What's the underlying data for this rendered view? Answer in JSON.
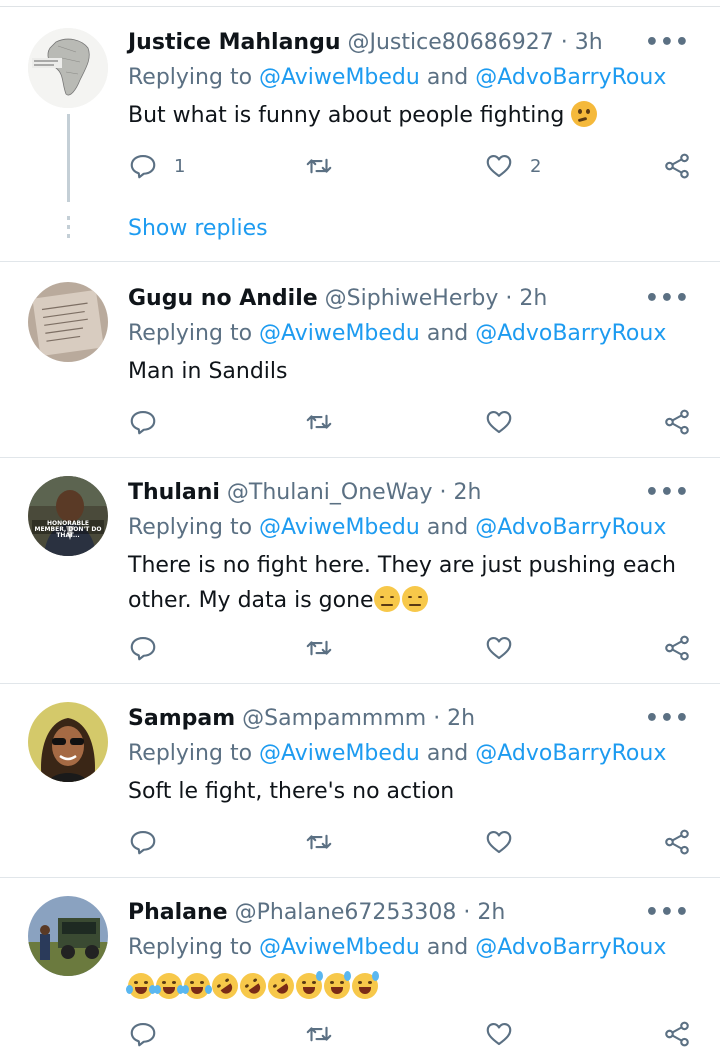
{
  "reply_prefix": "Replying to",
  "reply_join": "and",
  "tweets": [
    {
      "name": "Justice Mahlangu",
      "handle": "@Justice80686927",
      "time": "· 3h",
      "mentions": [
        "@AviweMbedu",
        "@AdvoBarryRoux"
      ],
      "text": "But what is funny about people fighting",
      "reply_count": "1",
      "like_count": "2",
      "show_replies": "Show replies"
    },
    {
      "name": "Gugu no Andile",
      "handle": "@SiphiweHerby",
      "time": "· 2h",
      "mentions": [
        "@AviweMbedu",
        "@AdvoBarryRoux"
      ],
      "text": "Man in Sandils"
    },
    {
      "name": "Thulani",
      "handle": "@Thulani_OneWay",
      "time": "· 2h",
      "mentions": [
        "@AviweMbedu",
        "@AdvoBarryRoux"
      ],
      "text_line1": "There is no fight here. They are just pushing each",
      "text_line2": "other. My data is gone",
      "avatar_caption": "HONORABLE MEMBER, DON'T DO THAT..."
    },
    {
      "name": "Sampam",
      "handle": "@Sampammmm",
      "time": "· 2h",
      "mentions": [
        "@AviweMbedu",
        "@AdvoBarryRoux"
      ],
      "text": "Soft le fight, there's no action"
    },
    {
      "name": "Phalane",
      "handle": "@Phalane67253308",
      "time": "· 2h",
      "mentions": [
        "@AviweMbedu",
        "@AdvoBarryRoux"
      ],
      "emojis": [
        "joy",
        "joy",
        "joy",
        "rofl",
        "rofl",
        "rofl",
        "sweat",
        "sweat",
        "sweat"
      ]
    }
  ],
  "more_label": "•••",
  "icons": {
    "reply": "reply-icon",
    "retweet": "retweet-icon",
    "like": "like-icon",
    "share": "share-icon",
    "more": "more-icon"
  },
  "colors": {
    "link": "#1d9bf0",
    "secondary": "#5b7083",
    "divider": "#e1e6ea"
  }
}
